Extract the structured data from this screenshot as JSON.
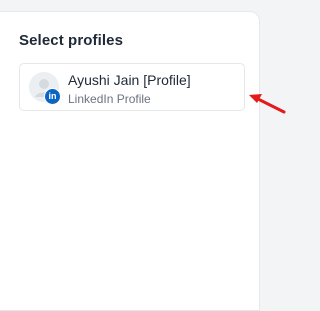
{
  "panel": {
    "title": "Select profiles"
  },
  "profiles": [
    {
      "name": "Ayushi Jain [Profile]",
      "type": "LinkedIn Profile",
      "badge": "in"
    }
  ],
  "colors": {
    "linkedin": "#0a66c2",
    "annotation_arrow": "#e31b1b"
  }
}
